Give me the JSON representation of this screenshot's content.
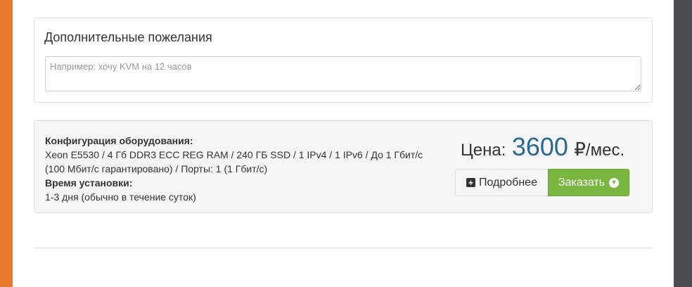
{
  "wishes": {
    "title": "Дополнительные пожелания",
    "placeholder": "Например: хочу KVM на 12 часов",
    "value": ""
  },
  "config": {
    "hardware_label": "Конфигурация оборудования:",
    "hardware_line1": "Xeon E5530 / 4 Гб DDR3 ECC REG RAM / 240 ГБ SSD / 1 IPv4 / 1 IPv6 / До 1 Гбит/с",
    "hardware_line2": "(100 Мбит/с гарантировано) / Порты: 1 (1 Гбит/с)",
    "setup_label": "Время установки:",
    "setup_value": "1-3 дня (обычно в течение суток)"
  },
  "price": {
    "label": "Цена:",
    "value": "3600",
    "currency": "₽",
    "period": "/мес."
  },
  "buttons": {
    "details_label": "Подробнее",
    "order_label": "Заказать"
  },
  "icons": {
    "details": "plus-square-icon",
    "order": "chevron-circle-down-icon"
  },
  "colors": {
    "price": "#2b6a8c",
    "order_button": "#7ab640",
    "left_accent": "#e8782a",
    "right_sidebar": "#4a4d52"
  }
}
